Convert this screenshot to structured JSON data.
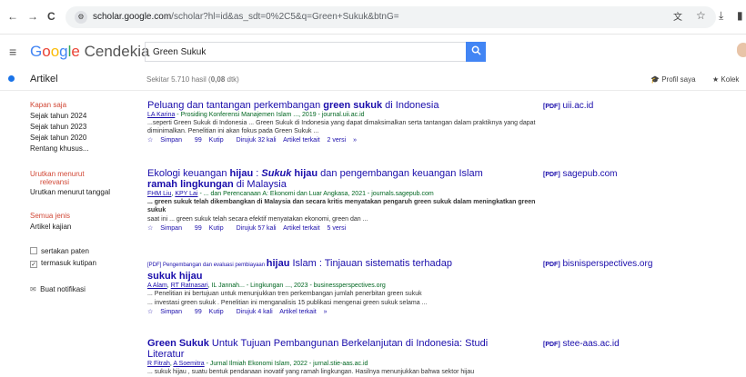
{
  "browser": {
    "back": "←",
    "forward": "→",
    "reload": "C",
    "url_host": "scholar.google.com",
    "url_path": "/scholar?hl=id&as_sdt=0%2C5&q=Green+Sukuk&btnG="
  },
  "header": {
    "logo_g": "G",
    "logo_o1": "o",
    "logo_o2": "o",
    "logo_g2": "g",
    "logo_l": "l",
    "logo_e": "e",
    "logo_rest": " Cendekia",
    "search_value": "Green Sukuk"
  },
  "subheader": {
    "section": "Artikel",
    "count_prefix": "Sekitar 5.710 hasil (",
    "count_time": "0,08",
    "count_suffix": " dtk)",
    "profil": "Profil saya",
    "kolek": "Kolek"
  },
  "sidebar": {
    "time_title": "Kapan saja",
    "time_items": [
      "Sejak tahun 2024",
      "Sejak tahun 2023",
      "Sejak tahun 2020",
      "Rentang khusus..."
    ],
    "sort_title_1": "Urutkan menurut",
    "sort_title_2": "relevansi",
    "sort_date": "Urutkan menurut tanggal",
    "type_title": "Semua jenis",
    "type_review": "Artikel kajian",
    "patent": "sertakan paten",
    "citations": "termasuk kutipan",
    "alert": "Buat notifikasi"
  },
  "results": [
    {
      "title_a": "Peluang dan tantangan perkembangan ",
      "title_b": "green sukuk",
      "title_c": " di Indonesia",
      "author": "LA Karina",
      "meta_rest": " - Prosiding Konferensi Manajemen Islam ..., 2019 - journal.uii.ac.id",
      "snippet": "...seperti Green Sukuk di Indonesia ... Green Sukuk di Indonesia yang dapat dimaksimalkan serta tantangan dalam praktiknya yang dapat diminimalkan. Penelitian ini akan fokus pada Green Sukuk ...",
      "save": "Simpan",
      "cite": "Kutip",
      "cited_by": "Dirujuk 32 kali",
      "related": "Artikel terkait",
      "versions": "2 versi",
      "pdf_tag": "[PDF]",
      "pdf_source": "uii.ac.id"
    },
    {
      "title_a": "Ekologi keuangan ",
      "title_b": "hijau",
      "title_c": " : ",
      "title_d": "Sukuk",
      "title_e": " hijau",
      "title_f": " dan pengembangan keuangan Islam",
      "title_g": "ramah lingkungan",
      "title_h": " di Malaysia",
      "author_1": "FHM Liu",
      "author_2": "KPY Lai",
      "meta_rest": " - ... dan Perencanaan A: Ekonomi dan Luar Angkasa, 2021 - journals.sagepub.com",
      "snippet_1": "... green sukuk telah dikembangkan di Malaysia dan secara kritis menyatakan pengaruh green sukuk dalam meningkatkan green sukuk",
      "snippet_2": "saat ini ... green sukuk telah secara efektif menyatakan ekonomi, green dan ...",
      "save": "Simpan",
      "cite": "Kutip",
      "cited_by": "Dirujuk 57 kali",
      "related": "Artikel terkait",
      "versions": "5 versi",
      "pdf_tag": "[PDF]",
      "pdf_source": "sagepub.com"
    },
    {
      "title_pre": "[PDF] Pengembangan dan evaluasi pembiayaan ",
      "title_a": "hijau",
      "title_b": " Islam : Tinjauan sistematis terhadap",
      "title_c": "sukuk hijau",
      "author_1": "A Alam",
      "author_2": "RT Ratnasari",
      "meta_rest": ", IL Jannah... - Lingkungan ..., 2023 - businessperspectives.org",
      "snippet_1": "... Penelitian ini bertujuan untuk menunjukkan tren perkembangan jumlah penerbitan green sukuk",
      "snippet_2": "... investasi green sukuk . Penelitian ini menganalisis 15 publikasi mengenai green sukuk selama ...",
      "save": "Simpan",
      "cite": "Kutip",
      "cited_by": "Dirujuk 4 kali",
      "related": "Artikel terkait",
      "pdf_tag": "[PDF]",
      "pdf_source": "bisnisperspectives.org"
    },
    {
      "title_a": "Green Sukuk",
      "title_b": " Untuk Tujuan Pembangunan Berkelanjutan di Indonesia: Studi",
      "title_c": "Literatur",
      "author_1": "R Fitrah",
      "author_2": "A Soemitra",
      "meta_rest": " - Jurnal Ilmiah Ekonomi Islam, 2022 - jurnal.stie-aas.ac.id",
      "snippet": "... sukuk hijau , suatu bentuk pendanaan inovatif yang ramah lingkungan. Hasilnya menunjukkan bahwa sektor hijau",
      "pdf_tag": "[PDF]",
      "pdf_source": "stee-aas.ac.id"
    }
  ]
}
